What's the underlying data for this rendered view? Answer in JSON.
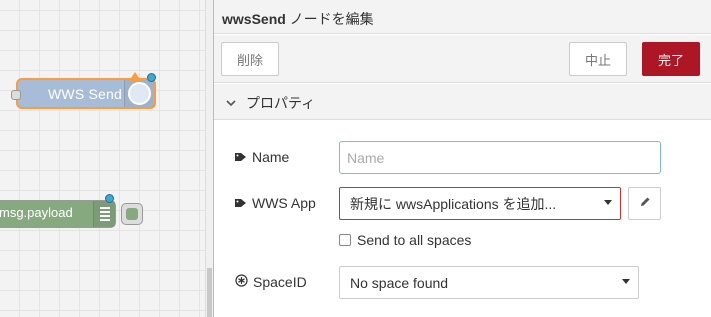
{
  "workspace": {
    "nodes": [
      {
        "label": "WWS Send"
      },
      {
        "label": "msg.payload"
      }
    ]
  },
  "tray": {
    "title_node": "wwsSend",
    "title_rest": " ノードを編集",
    "buttons": {
      "delete": "削除",
      "cancel": "中止",
      "done": "完了"
    },
    "section_title": "プロパティ",
    "fields": {
      "name": {
        "label": "Name",
        "value": "",
        "placeholder": "Name"
      },
      "app": {
        "label": "WWS App",
        "value": "新規に wwsApplications を追加..."
      },
      "send_all": {
        "label": "Send to all spaces",
        "checked": false
      },
      "space": {
        "label": "SpaceID",
        "value": "No space found"
      }
    }
  },
  "colors": {
    "done_button": "#ad1625",
    "wws_node": "#a7bcd6",
    "debug_node": "#87a980",
    "selected_border": "#ff9a3d",
    "invalid_border": "#c0392b"
  }
}
